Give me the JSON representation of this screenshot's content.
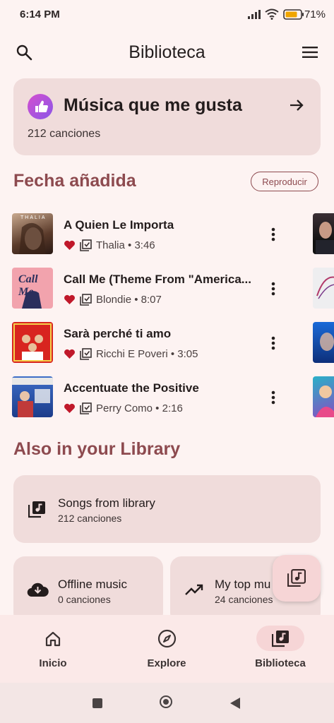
{
  "status_bar": {
    "time": "6:14 PM",
    "battery_percent": "71%"
  },
  "header": {
    "title": "Biblioteca",
    "search_icon": "search-icon",
    "menu_icon": "menu-icon"
  },
  "liked_card": {
    "title": "Música que me gusta",
    "count": "212 canciones"
  },
  "recent_section": {
    "title": "Fecha añadida",
    "play_label": "Reproducir"
  },
  "songs": [
    {
      "title": "A Quien Le Importa",
      "meta": "Thalia • 3:46"
    },
    {
      "title": "Call Me (Theme From \"America...",
      "meta": "Blondie • 8:07"
    },
    {
      "title": "Sarà perché ti amo",
      "meta": "Ricchi E Poveri • 3:05"
    },
    {
      "title": "Accentuate the Positive",
      "meta": "Perry Como • 2:16"
    }
  ],
  "covers": {
    "c1_label": "THALIA",
    "c2_label": "Call Me"
  },
  "library_section": {
    "title": "Also in your Library",
    "songs_card": {
      "title": "Songs from library",
      "count": "212 canciones"
    },
    "offline_card": {
      "title": "Offline music",
      "count": "0 canciones"
    },
    "top_card": {
      "title": "My top mu",
      "count": "24 canciones"
    }
  },
  "bottom_nav": {
    "home": "Inicio",
    "explore": "Explore",
    "library": "Biblioteca"
  },
  "colors": {
    "accent": "#8d4a4f",
    "card": "#f0dcdb",
    "background": "#fdf3f2",
    "heart": "#c0182a"
  }
}
